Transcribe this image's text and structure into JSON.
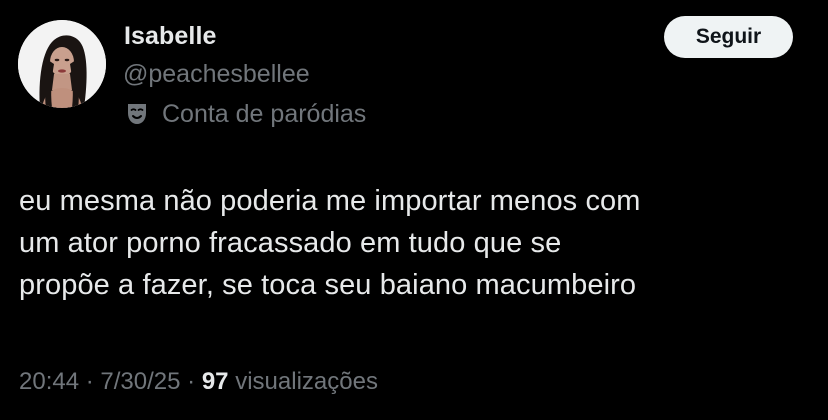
{
  "author": {
    "display_name": "Isabelle",
    "handle": "@peachesbellee",
    "parody_label": "Conta de paródias",
    "avatar_icon": "profile-photo"
  },
  "follow_button": {
    "label": "Seguir"
  },
  "tweet": {
    "lines": [
      "eu mesma não poderia me importar menos com",
      "um ator porno fracassado em tudo que se",
      "propõe a fazer, se toca seu baiano macumbeiro"
    ]
  },
  "meta": {
    "time": "20:44",
    "separator": "·",
    "date": "7/30/25",
    "views_count": "97",
    "views_label": "visualizações"
  },
  "colors": {
    "background": "#000000",
    "primary_text": "#e7e9ea",
    "secondary_text": "#71767b",
    "button_bg": "#eff3f4"
  }
}
